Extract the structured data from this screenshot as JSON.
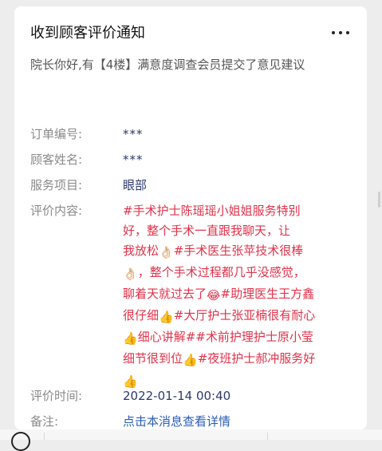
{
  "card": {
    "title": "收到顾客评价通知",
    "intro": "院长你好,有【4楼】满意度调查会员提交了意见建议",
    "fields": {
      "order_no": {
        "label": "订单编号:",
        "value": "***"
      },
      "customer": {
        "label": "顾客姓名:",
        "value": "***"
      },
      "service": {
        "label": "服务项目:",
        "value": "眼部"
      },
      "review": {
        "label": "评价内容:",
        "lines": [
          "#手术护士陈瑶瑶小姐姐服务特别",
          "好，整个手术一直跟我聊天，让",
          "我放松",
          "#手术医生张苹技术很棒",
          "，整个手术过程都几乎没感觉，",
          "聊着天就过去了",
          "#助理医生王方鑫",
          "很仔细",
          "#大厅护士张亚楠很有耐心",
          "细心讲解##术前护理护士原小莹",
          "细节很到位",
          "#夜班护士郝冲服务好"
        ],
        "emoji": {
          "thumbs": "👍",
          "ok": "👌🏻",
          "laugh": "😂"
        }
      },
      "time": {
        "label": "评价时间:",
        "value": "2022-01-14 00:40"
      },
      "note": {
        "label": "备注:",
        "value": "点击本消息查看详情"
      }
    }
  }
}
